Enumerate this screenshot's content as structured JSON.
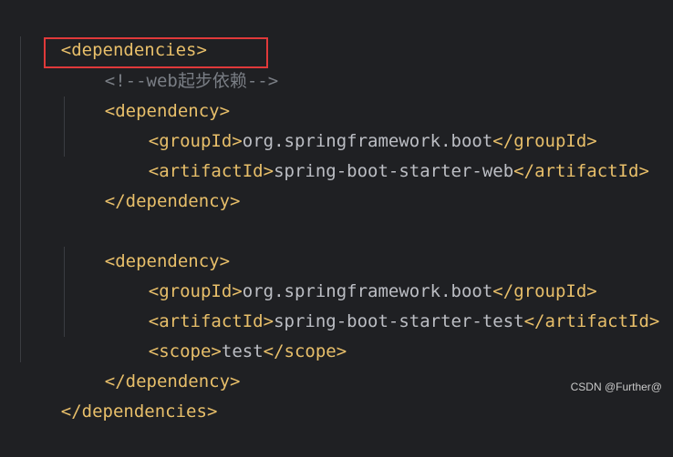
{
  "code": {
    "lines": [
      {
        "open": "<",
        "tag": "dependencies",
        "close": ">"
      },
      {
        "comment": "<!--web起步依赖-->"
      },
      {
        "open": "<",
        "tag": "dependency",
        "close": ">"
      },
      {
        "open1": "<",
        "tag1": "groupId",
        "close1": ">",
        "text": "org.springframework.boot",
        "open2": "</",
        "tag2": "groupId",
        "close2": ">"
      },
      {
        "open1": "<",
        "tag1": "artifactId",
        "close1": ">",
        "text": "spring-boot-starter-web",
        "open2": "</",
        "tag2": "artifactId",
        "close2": ">"
      },
      {
        "open": "</",
        "tag": "dependency",
        "close": ">"
      },
      {},
      {
        "open": "<",
        "tag": "dependency",
        "close": ">"
      },
      {
        "open1": "<",
        "tag1": "groupId",
        "close1": ">",
        "text": "org.springframework.boot",
        "open2": "</",
        "tag2": "groupId",
        "close2": ">"
      },
      {
        "open1": "<",
        "tag1": "artifactId",
        "close1": ">",
        "text": "spring-boot-starter-test",
        "open2": "</",
        "tag2": "artifactId",
        "close2": ">"
      },
      {
        "open1": "<",
        "tag1": "scope",
        "close1": ">",
        "text": "test",
        "open2": "</",
        "tag2": "scope",
        "close2": ">"
      },
      {
        "open": "</",
        "tag": "dependency",
        "close": ">"
      },
      {
        "open": "</",
        "tag": "dependencies",
        "close": ">"
      }
    ]
  },
  "watermark": "CSDN @Further@",
  "colors": {
    "background": "#1f2023",
    "tag": "#e8bf6a",
    "text": "#bcbec4",
    "comment": "#7a7e85",
    "highlight": "#e0393a"
  }
}
